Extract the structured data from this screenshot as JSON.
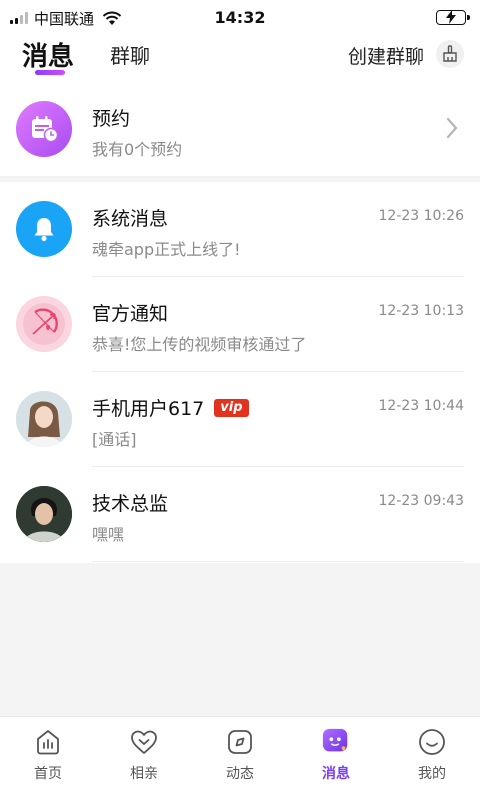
{
  "status_bar": {
    "carrier": "中国联通",
    "time": "14:32"
  },
  "header": {
    "tab_messages": "消息",
    "tab_group_chat": "群聊",
    "create_group": "创建群聊"
  },
  "reservation": {
    "title": "预约",
    "subtitle": "我有0个预约"
  },
  "messages": [
    {
      "name": "系统消息",
      "preview": "魂牵app正式上线了!",
      "time": "12-23 10:26"
    },
    {
      "name": "官方通知",
      "preview": "恭喜!您上传的视频审核通过了",
      "time": "12-23 10:13"
    },
    {
      "name": "手机用户617",
      "badge": "vip",
      "preview": "[通话]",
      "time": "12-23 10:44"
    },
    {
      "name": "技术总监",
      "preview": "嘿嘿",
      "time": "12-23 09:43"
    }
  ],
  "tabbar": [
    {
      "label": "首页",
      "icon": "home-icon"
    },
    {
      "label": "相亲",
      "icon": "heart-icon"
    },
    {
      "label": "动态",
      "icon": "compass-icon"
    },
    {
      "label": "消息",
      "icon": "message-icon",
      "active": true
    },
    {
      "label": "我的",
      "icon": "smile-icon"
    }
  ],
  "colors": {
    "accent": "#7b3ff2",
    "vip": "#e2331f"
  }
}
